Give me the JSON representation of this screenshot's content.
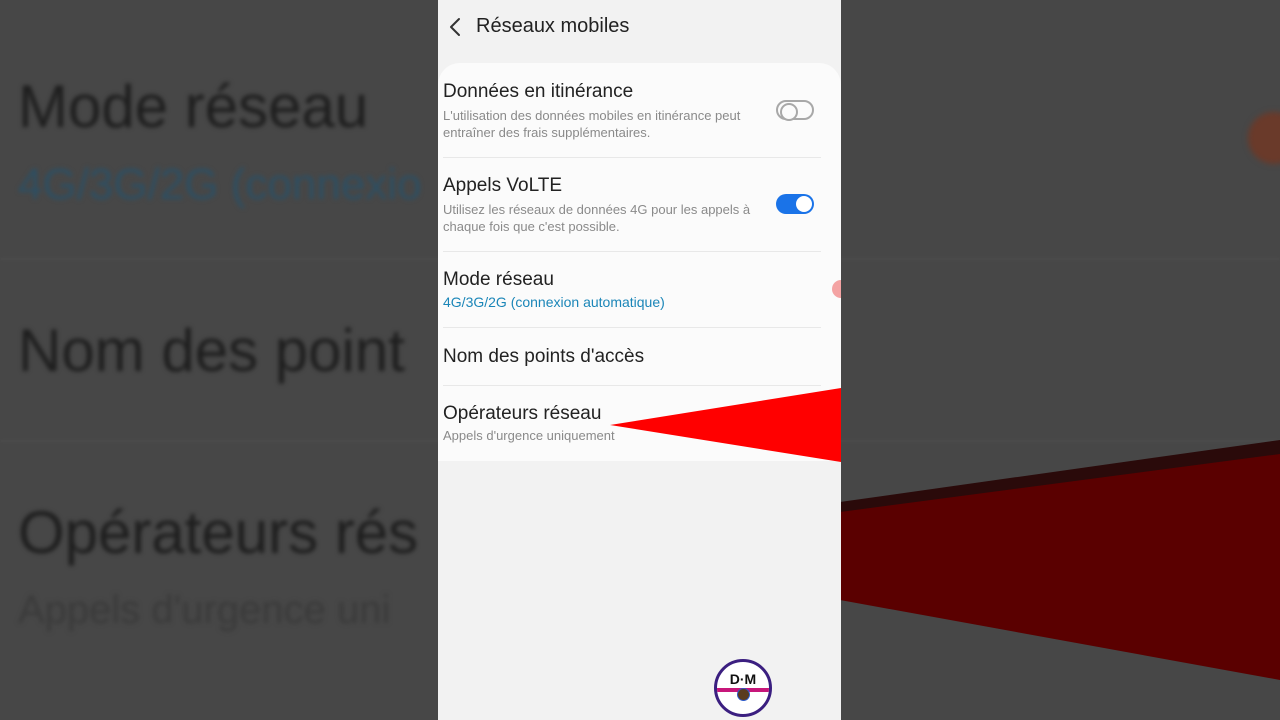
{
  "background": {
    "title": "Mode réseau",
    "subtitle": "4G/3G/2G (connexio",
    "item2": "Nom des point",
    "item3": "Opérateurs rés",
    "item3_sub": "Appels d'urgence uni"
  },
  "header": {
    "title": "Réseaux mobiles",
    "back_icon": "chevron-left-icon"
  },
  "settings": {
    "roaming": {
      "title": "Données en itinérance",
      "subtitle": "L'utilisation des données mobiles en itinérance peut entraîner des frais supplémentaires.",
      "enabled": false
    },
    "volte": {
      "title": "Appels VoLTE",
      "subtitle": "Utilisez les réseaux de données 4G pour les appels à chaque fois que c'est possible.",
      "enabled": true
    },
    "network_mode": {
      "title": "Mode réseau",
      "value": "4G/3G/2G (connexion automatique)"
    },
    "apn": {
      "title": "Nom des points d'accès"
    },
    "operators": {
      "title": "Opérateurs réseau",
      "subtitle": "Appels d'urgence uniquement"
    }
  },
  "logo": {
    "letters": "D·M"
  },
  "colors": {
    "accent": "#1a73e8",
    "link_blue": "#1b86b8",
    "arrow_red": "#ff0000"
  }
}
